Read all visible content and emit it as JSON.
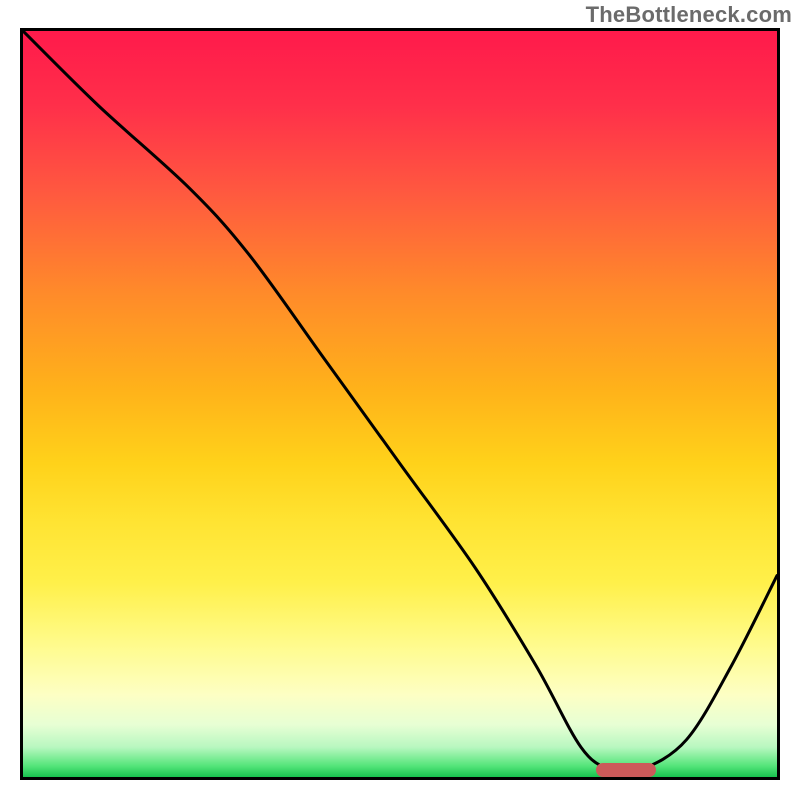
{
  "watermark": "TheBottleneck.com",
  "chart_data": {
    "type": "line",
    "title": "",
    "xlabel": "",
    "ylabel": "",
    "xlim": [
      0,
      100
    ],
    "ylim": [
      0,
      100
    ],
    "grid": false,
    "curve": {
      "x": [
        0,
        10,
        22,
        30,
        40,
        50,
        60,
        68,
        74,
        78,
        82,
        88,
        94,
        100
      ],
      "y": [
        100,
        90,
        79,
        70,
        56,
        42,
        28,
        15,
        4,
        1,
        1,
        5,
        15,
        27
      ]
    },
    "marker": {
      "x_start": 76,
      "x_end": 84,
      "y": 1,
      "color": "#cc5a5a"
    },
    "gradient_stops": [
      {
        "pos": 0,
        "color": "#ff1a4b"
      },
      {
        "pos": 0.5,
        "color": "#ffd21a"
      },
      {
        "pos": 0.9,
        "color": "#fdffc4"
      },
      {
        "pos": 1.0,
        "color": "#18c24f"
      }
    ]
  }
}
